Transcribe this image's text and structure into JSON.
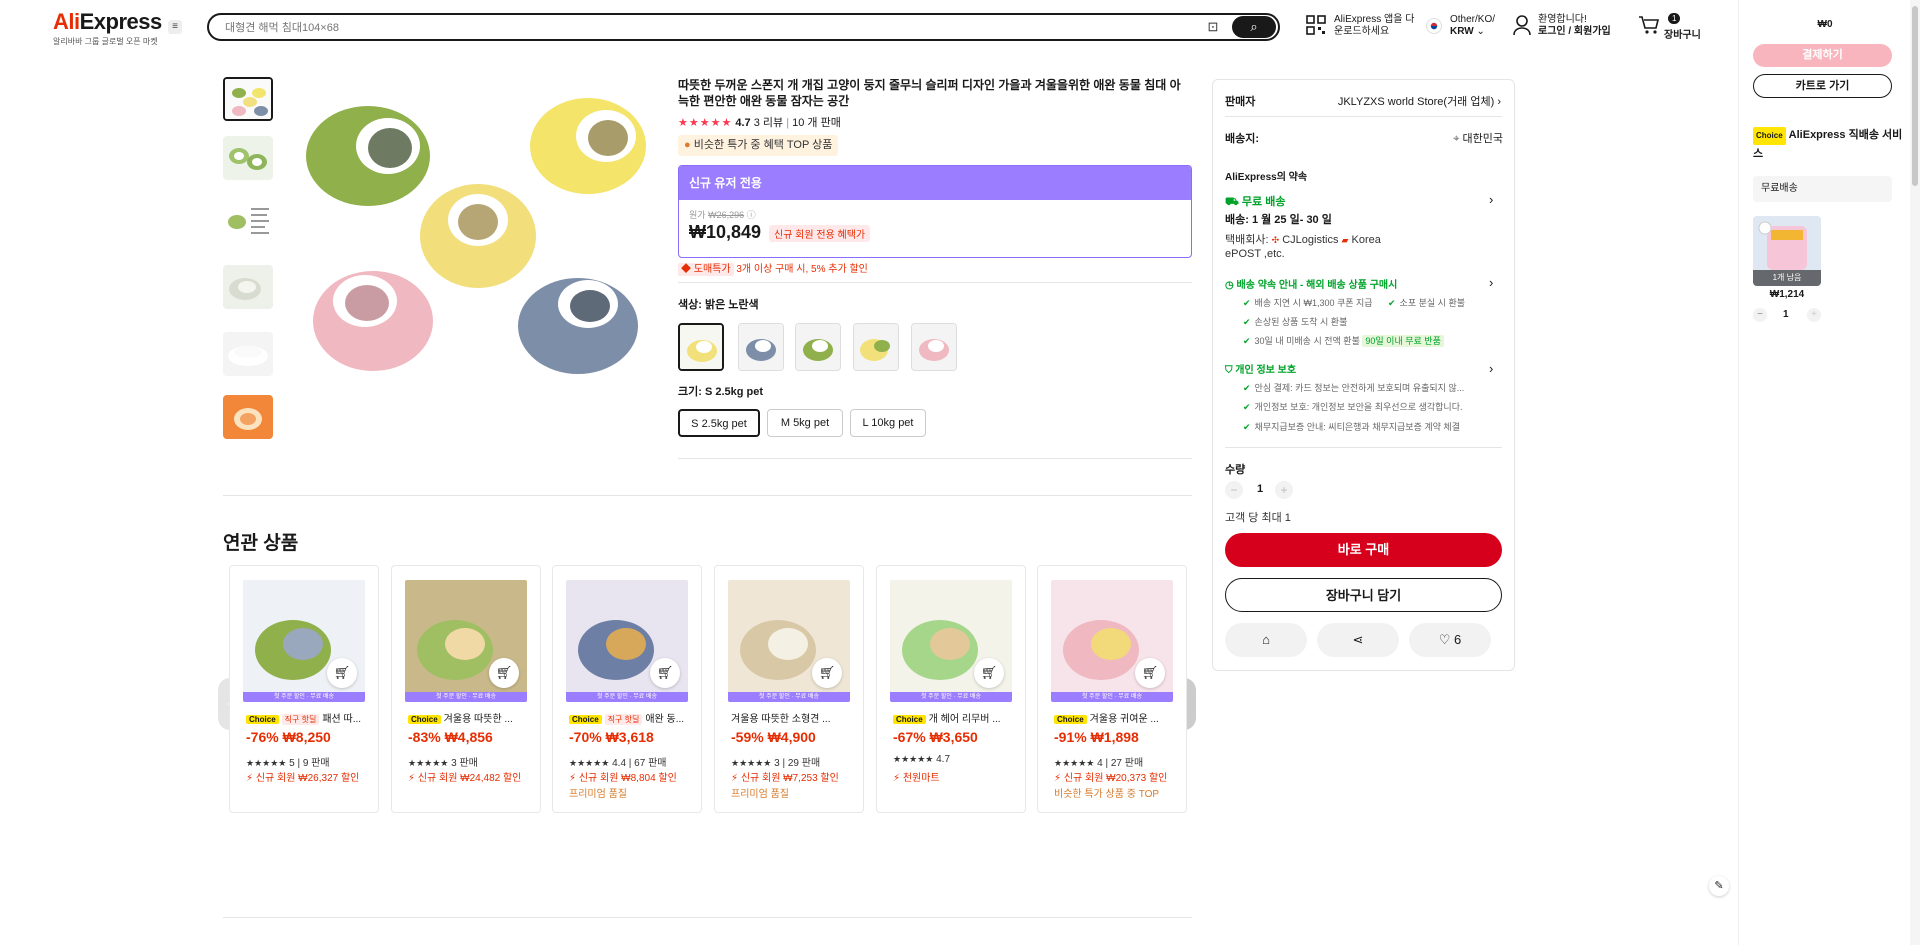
{
  "header": {
    "logo": "AliExpress",
    "logo_sub": "알리바바 그룹 글로벌 오픈 마켓",
    "search_placeholder": "대형견 해먹 침대104×68",
    "app_line1": "AliExpress 앱을 다",
    "app_line2": "운로드하세요",
    "region_line1": "Other/KO/",
    "region_line2": "KRW",
    "account_line1": "환영합니다!",
    "account_line2": "로그인 / 회원가입",
    "cart_count": "1",
    "cart_label": "장바구니"
  },
  "gallery": {
    "thumb_count": 6
  },
  "product": {
    "title": "따뜻한 두꺼운 스폰지 개 개집 고양이 둥지 줄무늬 슬리퍼 디자인 가을과 겨울을위한 애완 동물 침대 아늑한 편안한 애완 동물 잠자는 공간",
    "rating": "4.7",
    "reviews": "3 리뷰",
    "sold": "10 개 판매",
    "top_badge": "비슷한 특가 중 혜택 TOP 상품",
    "new_user_label": "신규 유저 전용",
    "original_price_label": "원가",
    "original_price": "₩26,296",
    "price": "₩10,849",
    "price_tag": "신규 회원 전용 혜택가",
    "bulk_badge": "도매특가",
    "bulk_text": "3개 이상 구매 시, 5% 추가 할인",
    "color_label": "색상: 밝은 노란색",
    "size_label": "크기: S 2.5kg pet",
    "sizes": [
      "S 2.5kg pet",
      "M 5kg pet",
      "L 10kg pet"
    ]
  },
  "seller": {
    "seller_label": "판매자",
    "seller_name": "JKLYZXS world Store(거래 업체)",
    "ship_to_label": "배송지:",
    "ship_to": "대한민국",
    "promise_title": "AliExpress의 약속",
    "free_ship": "무료 배송",
    "delivery": "배송: 1 월 25 일- 30 일",
    "carrier_label": "택배회사:",
    "carrier1": "CJLogistics",
    "carrier2": "Korea",
    "carrier3": "ePOST ,etc.",
    "promise_head": "배송 약속 안내 - 해외 배송 상품 구매시",
    "promise_items": [
      "배송 지연 시 ₩1,300 쿠폰 지급",
      "소포 분실 시 환불",
      "손상된 상품 도착 시 환불",
      "30일 내 미배송 시 전액 환불"
    ],
    "return_badge": "90일 이내 무료 반품",
    "privacy_head": "개인 정보 보호",
    "privacy_items": [
      "안심 결제: 카드 정보는 안전하게 보호되며 유출되지 않...",
      "개인정보 보호: 개인정보 보안을 최우선으로 생각합니다.",
      "채무지급보증 안내: 씨티은행과 채무지급보증 계약 체결"
    ],
    "qty_label": "수량",
    "qty": "1",
    "max_label": "고객 당 최대 1",
    "buy_now": "바로 구매",
    "add_cart": "장바구니 담기",
    "like_count": "6"
  },
  "related": {
    "title": "연관 상품",
    "banner_text": "첫 주문 할인 · 무료 배송",
    "items": [
      {
        "choice": "Choice",
        "deal": "직구 핫딜",
        "name": "패션 따...",
        "price": "-76% ₩8,250",
        "meta": "5 | 9 판매",
        "new": "신규 회원 ₩26,327 할인",
        "extra": ""
      },
      {
        "choice": "Choice",
        "deal": "",
        "name": "겨울용 따뜻한 ...",
        "price": "-83% ₩4,856",
        "meta": "3 판매",
        "new": "신규 회원 ₩24,482 할인",
        "extra": ""
      },
      {
        "choice": "Choice",
        "deal": "직구 핫딜",
        "name": "애완 동...",
        "price": "-70% ₩3,618",
        "meta": "4.4 | 67 판매",
        "new": "신규 회원 ₩8,804 할인",
        "extra": "프리미엄 품질"
      },
      {
        "choice": "",
        "deal": "",
        "name": "겨울용 따뜻한 소형견 ...",
        "price": "-59% ₩4,900",
        "meta": "3 | 29 판매",
        "new": "신규 회원 ₩7,253 할인",
        "extra": "프리미엄 품질"
      },
      {
        "choice": "Choice",
        "deal": "",
        "name": "개 헤어 리무버 ...",
        "price": "-67% ₩3,650",
        "meta": "4.7",
        "new": "천원마트",
        "extra": ""
      },
      {
        "choice": "Choice",
        "deal": "",
        "name": "겨울용 귀여운 ...",
        "price": "-91% ₩1,898",
        "meta": "4 | 27 판매",
        "new": "신규 회원 ₩20,373 할인",
        "extra": "비슷한 특가 상품 중 TOP"
      }
    ]
  },
  "rpanel": {
    "total": "₩0",
    "checkout": "결제하기",
    "go_cart": "카트로 가기",
    "choice": "Choice",
    "service": "AliExpress 직배송 서비스",
    "free": "무료배송",
    "stock": "1개 남음",
    "item_price": "₩1,214",
    "item_qty": "1"
  },
  "colors": {
    "brand_red": "#e62e04",
    "buy_red": "#d6001c",
    "purple": "#9b7dff",
    "green": "#00a32a"
  }
}
